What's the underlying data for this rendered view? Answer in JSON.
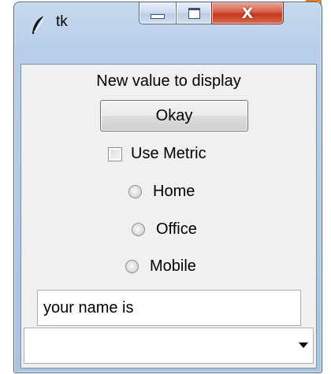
{
  "window": {
    "title": "tk",
    "minimize_icon": "minimize-icon",
    "maximize_icon": "maximize-icon",
    "close_icon": "close-icon",
    "close_glyph": "X",
    "app_icon": "feather-icon"
  },
  "content": {
    "label": "New value to display",
    "okay_button": "Okay",
    "checkbox": {
      "label": "Use Metric",
      "checked": false
    },
    "radios": [
      {
        "label": "Home",
        "selected": false
      },
      {
        "label": "Office",
        "selected": false
      },
      {
        "label": "Mobile",
        "selected": false
      }
    ],
    "entry": {
      "value": "your name is"
    },
    "combobox": {
      "value": "",
      "arrow_icon": "dropdown-arrow-icon"
    }
  },
  "colors": {
    "close_button": "#c5361d",
    "frame": "#b9cfe9",
    "client": "#f0f0f0"
  }
}
